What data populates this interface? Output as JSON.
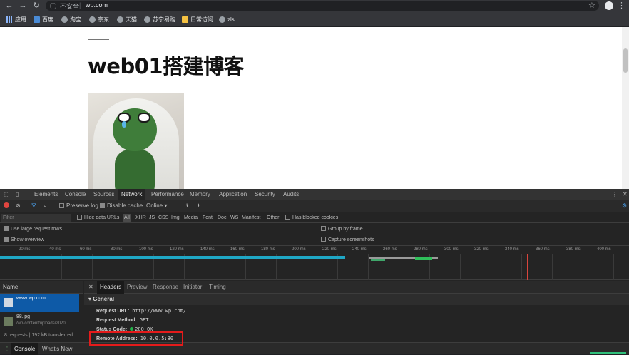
{
  "browser": {
    "security_label": "不安全",
    "url": "wp.com",
    "bookmarks": [
      "应用",
      "百度",
      "淘宝",
      "京东",
      "天猫",
      "苏宁易购",
      "日常访问",
      "zls"
    ]
  },
  "page": {
    "title": "web01搭建博客"
  },
  "devtools": {
    "tabs": [
      "Elements",
      "Console",
      "Sources",
      "Network",
      "Performance",
      "Memory",
      "Application",
      "Security",
      "Audits"
    ],
    "active_tab": "Network",
    "toolbar": {
      "preserve_log": "Preserve log",
      "disable_cache": "Disable cache",
      "throttle": "Online"
    },
    "filter": {
      "placeholder": "Filter",
      "hide_data_urls": "Hide data URLs",
      "all": "All",
      "types": [
        "XHR",
        "JS",
        "CSS",
        "Img",
        "Media",
        "Font",
        "Doc",
        "WS",
        "Manifest",
        "Other"
      ],
      "blocked_cookies": "Has blocked cookies"
    },
    "options": {
      "large_rows": "Use large request rows",
      "group_by_frame": "Group by frame",
      "show_overview": "Show overview",
      "capture_screenshots": "Capture screenshots"
    },
    "timeline_ticks": [
      "20 ms",
      "40 ms",
      "60 ms",
      "80 ms",
      "100 ms",
      "120 ms",
      "140 ms",
      "160 ms",
      "180 ms",
      "200 ms",
      "220 ms",
      "240 ms",
      "260 ms",
      "280 ms",
      "300 ms",
      "320 ms",
      "340 ms",
      "360 ms",
      "380 ms",
      "400 ms"
    ],
    "requests": {
      "header": "Name",
      "items": [
        {
          "name": "www.wp.com",
          "sub": ""
        },
        {
          "name": "88.jpg",
          "sub": "/wp-content/uploads/2020..."
        }
      ],
      "summary": "8 requests  |  192 kB transferred"
    },
    "detail": {
      "tabs": [
        "Headers",
        "Preview",
        "Response",
        "Initiator",
        "Timing"
      ],
      "active": "Headers",
      "general_label": "General",
      "rows": [
        {
          "key": "Request URL:",
          "value": "http://www.wp.com/"
        },
        {
          "key": "Request Method:",
          "value": "GET"
        },
        {
          "key": "Status Code:",
          "value": "200 OK"
        },
        {
          "key": "Remote Address:",
          "value": "10.0.0.5:80"
        }
      ]
    },
    "drawer": {
      "tabs": [
        "Console",
        "What's New"
      ]
    }
  }
}
